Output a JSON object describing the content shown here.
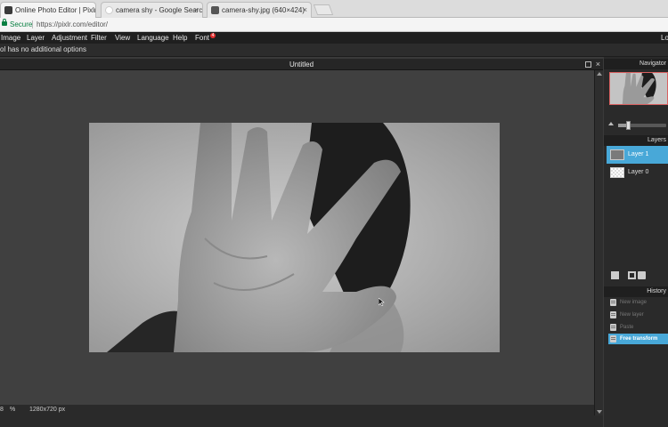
{
  "browser": {
    "tabs": [
      {
        "title": "Online Photo Editor | Pixlr Edit",
        "active": true,
        "icon": "pixlr-favicon"
      },
      {
        "title": "camera shy - Google Search",
        "active": false,
        "icon": "google-favicon"
      },
      {
        "title": "camera-shy.jpg (640×424)",
        "active": false,
        "icon": "image-favicon"
      }
    ],
    "close_glyph": "×",
    "secure_label": "Secure",
    "url": "https://pixlr.com/editor/"
  },
  "menu": {
    "items": [
      "Image",
      "Layer",
      "Adjustment",
      "Filter",
      "View",
      "Language",
      "Help",
      "Font"
    ],
    "font_badge": "4",
    "right_label": "Lo"
  },
  "options_bar": {
    "text": "ol has no additional options"
  },
  "document": {
    "title": "Untitled",
    "close_glyph": "×",
    "status": {
      "zoom": "8",
      "zoom_unit": "%",
      "dimensions": "1280x720 px"
    }
  },
  "navigator": {
    "title": "Navigator",
    "zoom_level": 0.2
  },
  "layers": {
    "title": "Layers",
    "items": [
      {
        "label": "Layer 1",
        "selected": true
      },
      {
        "label": "Layer 0",
        "selected": false
      }
    ]
  },
  "history": {
    "title": "History",
    "items": [
      {
        "label": "New image",
        "selected": false
      },
      {
        "label": "New layer",
        "selected": false
      },
      {
        "label": "Paste",
        "selected": false
      },
      {
        "label": "Free transform",
        "selected": true
      }
    ]
  },
  "colors": {
    "accent": "#48a8d8",
    "menubar": "#1f1f1f",
    "canvas_bg": "#404040",
    "badge": "#e53030"
  }
}
